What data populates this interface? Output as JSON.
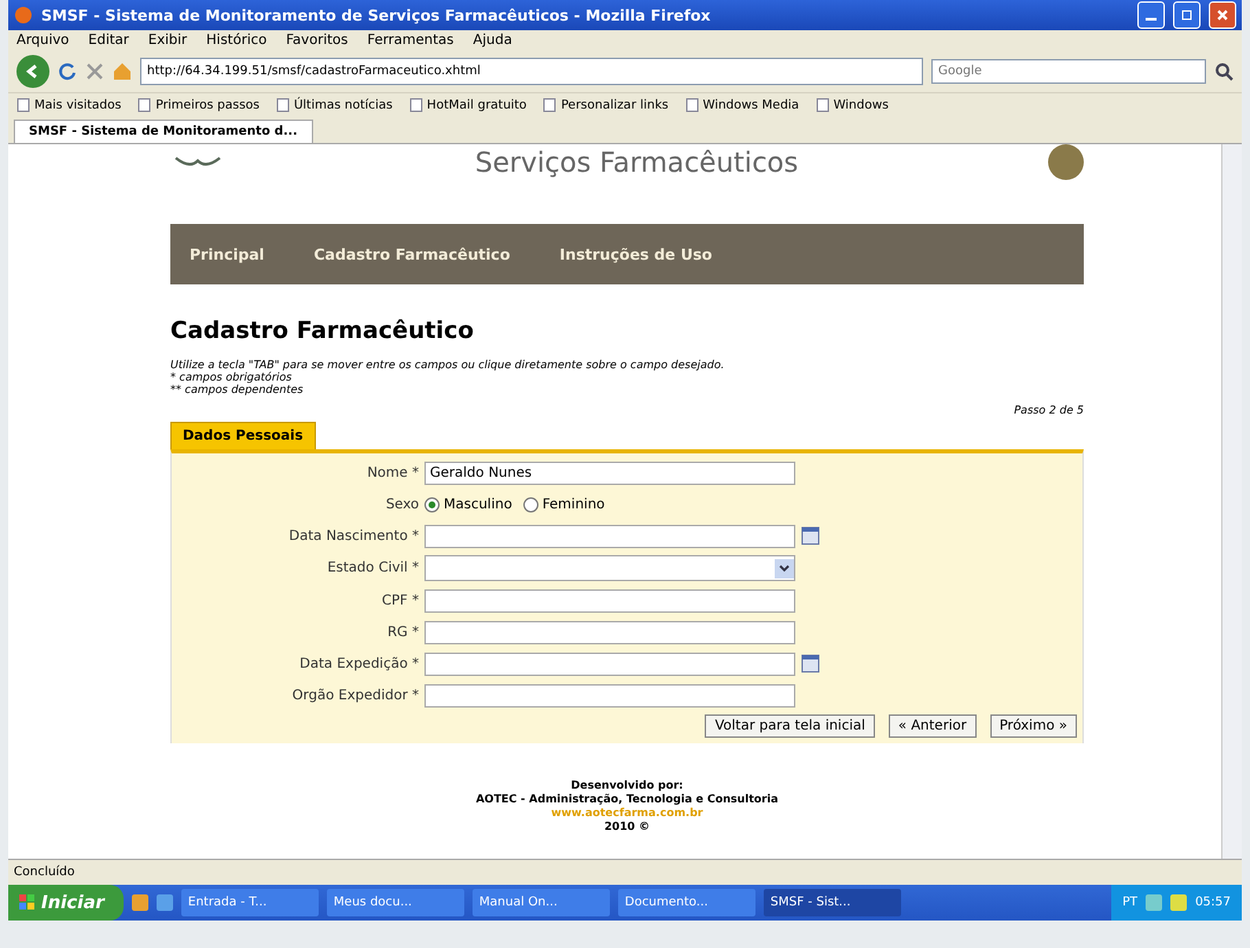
{
  "window": {
    "title": "SMSF - Sistema de Monitoramento de Serviços Farmacêuticos - Mozilla Firefox"
  },
  "menu": [
    "Arquivo",
    "Editar",
    "Exibir",
    "Histórico",
    "Favoritos",
    "Ferramentas",
    "Ajuda"
  ],
  "address": "http://64.34.199.51/smsf/cadastroFarmaceutico.xhtml",
  "search": {
    "placeholder": "Google"
  },
  "bookmarks": [
    "Mais visitados",
    "Primeiros passos",
    "Últimas notícias",
    "HotMail gratuito",
    "Personalizar links",
    "Windows Media",
    "Windows"
  ],
  "browser_tab": {
    "title": "SMSF - Sistema de Monitoramento d...",
    "selected": true
  },
  "page": {
    "banner_text": "Serviços Farmacêuticos",
    "nav": [
      "Principal",
      "Cadastro Farmacêutico",
      "Instruções de Uso"
    ],
    "heading": "Cadastro Farmacêutico",
    "instructions": [
      "Utilize a tecla \"TAB\" para se mover entre os campos ou clique diretamente sobre o campo desejado.",
      "* campos obrigatórios",
      "** campos dependentes"
    ],
    "step": "Passo 2 de 5",
    "form_tab": {
      "label": "Dados Pessoais",
      "selected": true
    },
    "fields": [
      {
        "kind": "text",
        "label": "Nome *",
        "value": "Geraldo Nunes"
      },
      {
        "kind": "radio",
        "label": "Sexo",
        "options": [
          {
            "label": "Masculino",
            "selected": true
          },
          {
            "label": "Feminino",
            "selected": false
          }
        ]
      },
      {
        "kind": "date",
        "label": "Data Nascimento *"
      },
      {
        "kind": "select",
        "label": "Estado Civil *"
      },
      {
        "kind": "text",
        "label": "CPF *"
      },
      {
        "kind": "text",
        "label": "RG *"
      },
      {
        "kind": "date",
        "label": "Data Expedição *"
      },
      {
        "kind": "text",
        "label": "Orgão Expedidor *"
      }
    ],
    "buttons": [
      "Voltar para tela inicial",
      "« Anterior",
      "Próximo »"
    ],
    "footer": [
      {
        "kind": "text",
        "text": "Desenvolvido por:"
      },
      {
        "kind": "text",
        "text": "AOTEC - Administração, Tecnologia e Consultoria"
      },
      {
        "kind": "link",
        "text": "www.aotecfarma.com.br"
      },
      {
        "kind": "text",
        "text": "2010 ©"
      }
    ]
  },
  "status_bar": "Concluído",
  "taskbar": {
    "start": "Iniciar",
    "tasks": [
      {
        "label": "Entrada - T...",
        "selected": false
      },
      {
        "label": "Meus docu...",
        "selected": false
      },
      {
        "label": "Manual On...",
        "selected": false
      },
      {
        "label": "Documento...",
        "selected": false
      },
      {
        "label": "SMSF - Sist...",
        "selected": true
      }
    ],
    "language": "PT",
    "clock": "05:57"
  }
}
